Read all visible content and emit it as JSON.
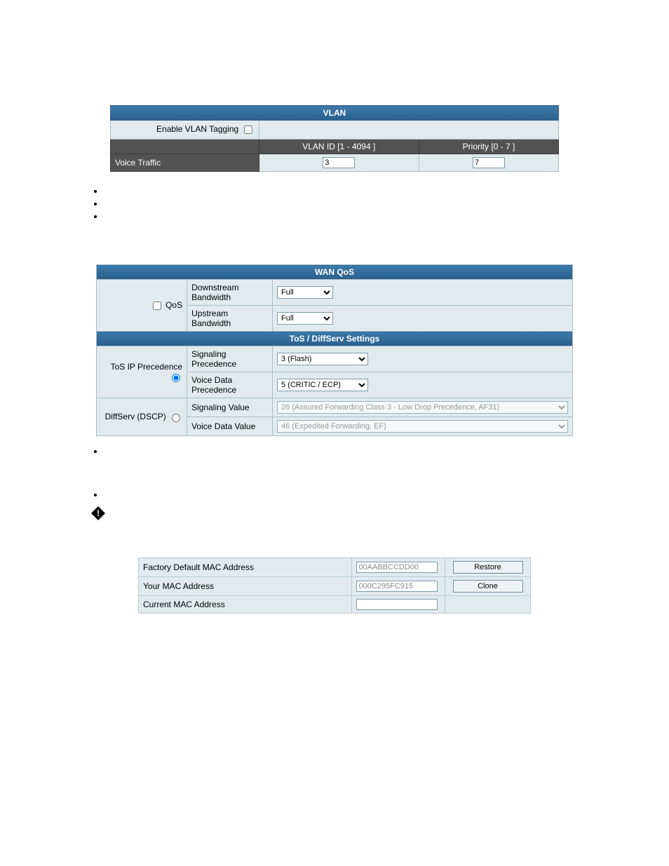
{
  "vlan": {
    "title": "VLAN",
    "enable_label": "Enable VLAN Tagging",
    "col_vlanid": "VLAN ID [1 - 4094 ]",
    "col_priority": "Priority [0 - 7 ]",
    "row_label": "Voice Traffic",
    "vlan_id_value": "3",
    "priority_value": "7"
  },
  "wanqos": {
    "title": "WAN QoS",
    "qos_label": "QoS",
    "down_label": "Downstream Bandwidth",
    "up_label": "Upstream Bandwidth",
    "down_value": "Full",
    "up_value": "Full",
    "tos_title": "ToS / DiffServ Settings",
    "tosip_label": "ToS IP Precedence",
    "diffserv_label": "DiffServ (DSCP)",
    "sig_prec_label": "Signaling Precedence",
    "voice_prec_label": "Voice Data Precedence",
    "sig_val_label": "Signaling Value",
    "voice_val_label": "Voice Data Value",
    "sig_prec_value": "3 (Flash)",
    "voice_prec_value": "5 (CRITIC / ECP)",
    "sig_value": "26 (Assured Forwarding Class 3 - Low Drop Precedence, AF31)",
    "voice_value": "46 (Expedited Forwarding, EF)"
  },
  "mac": {
    "factory_label": "Factory Default MAC Address",
    "your_label": "Your MAC Address",
    "current_label": "Current MAC Address",
    "factory_value": "00AABBCCDD00",
    "your_value": "000C295FC915",
    "current_value": "",
    "restore_btn": "Restore",
    "clone_btn": "Clone"
  }
}
